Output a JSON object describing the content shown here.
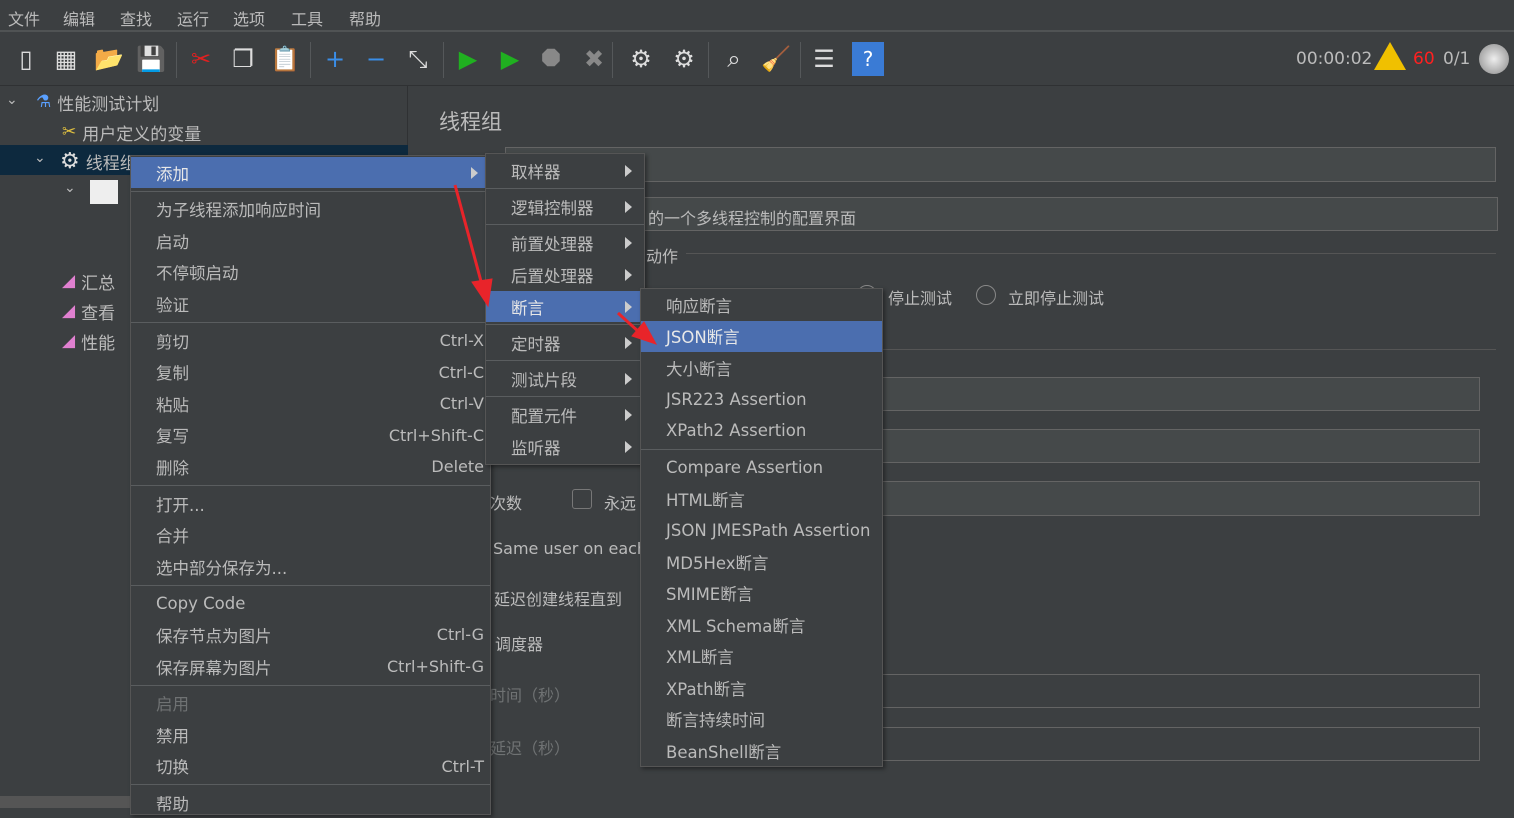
{
  "menubar": [
    "文件",
    "编辑",
    "查找",
    "运行",
    "选项",
    "工具",
    "帮助"
  ],
  "toolbar": {
    "timer": "00:00:02",
    "warning_count": "60",
    "threads": "0/1",
    "colors": {
      "warning_count": "#ff2020"
    },
    "icons": [
      "new-icon",
      "templates-icon",
      "open-icon",
      "save-icon",
      "cut-icon",
      "copy-icon",
      "paste-icon",
      "expand-icon",
      "collapse-icon",
      "toggle-icon",
      "start-icon",
      "start-no-pause-icon",
      "stop-icon",
      "shutdown-icon",
      "clear-icon",
      "clear-all-icon",
      "search-icon",
      "reset-search-icon",
      "function-helper-icon",
      "help-icon"
    ]
  },
  "tree": {
    "items": [
      "性能测试计划",
      "用户定义的变量",
      "线程组",
      "汇总",
      "查看",
      "性能"
    ]
  },
  "panel": {
    "title": "线程组",
    "comment": "的一个多线程控制的配置界面",
    "action_label": "动作",
    "stop_test": "停止测试",
    "stop_now": "立即停止测试",
    "loops": "次数",
    "forever": "永远",
    "same_user": "Same user on each",
    "delay_create": "延迟创建线程直到",
    "scheduler": "调度器",
    "duration": "时间（秒）",
    "startup_delay": "延迟（秒）"
  },
  "context_menu": {
    "groups": [
      [
        {
          "label": "添加",
          "submenu": true,
          "highlighted": true
        }
      ],
      [
        {
          "label": "为子线程添加响应时间"
        },
        {
          "label": "启动"
        },
        {
          "label": "不停顿启动"
        },
        {
          "label": "验证"
        }
      ],
      [
        {
          "label": "剪切",
          "shortcut": "Ctrl-X"
        },
        {
          "label": "复制",
          "shortcut": "Ctrl-C"
        },
        {
          "label": "粘贴",
          "shortcut": "Ctrl-V"
        },
        {
          "label": "复写",
          "shortcut": "Ctrl+Shift-C"
        },
        {
          "label": "删除",
          "shortcut": "Delete"
        }
      ],
      [
        {
          "label": "打开..."
        },
        {
          "label": "合并"
        },
        {
          "label": "选中部分保存为..."
        }
      ],
      [
        {
          "label": "Copy Code"
        },
        {
          "label": "保存节点为图片",
          "shortcut": "Ctrl-G"
        },
        {
          "label": "保存屏幕为图片",
          "shortcut": "Ctrl+Shift-G"
        }
      ],
      [
        {
          "label": "启用",
          "disabled": true
        },
        {
          "label": "禁用"
        },
        {
          "label": "切换",
          "shortcut": "Ctrl-T"
        }
      ],
      [
        {
          "label": "帮助"
        }
      ]
    ]
  },
  "add_submenu": [
    {
      "label": "取样器"
    },
    {
      "label": "逻辑控制器"
    },
    {
      "label": "前置处理器"
    },
    {
      "label": "后置处理器"
    },
    {
      "label": "断言",
      "highlighted": true
    },
    {
      "label": "定时器"
    },
    {
      "label": "测试片段"
    },
    {
      "label": "配置元件"
    },
    {
      "label": "监听器"
    }
  ],
  "assertion_submenu": [
    {
      "label": "响应断言"
    },
    {
      "label": "JSON断言",
      "highlighted": true
    },
    {
      "label": "大小断言"
    },
    {
      "label": "JSR223 Assertion"
    },
    {
      "label": "XPath2 Assertion"
    },
    {
      "label": "Compare Assertion"
    },
    {
      "label": "HTML断言"
    },
    {
      "label": "JSON JMESPath Assertion"
    },
    {
      "label": "MD5Hex断言"
    },
    {
      "label": "SMIME断言"
    },
    {
      "label": "XML Schema断言"
    },
    {
      "label": "XML断言"
    },
    {
      "label": "XPath断言"
    },
    {
      "label": "断言持续时间"
    },
    {
      "label": "BeanShell断言"
    }
  ],
  "colors": {
    "background": "#3c3f41",
    "highlight": "#4b6eaf",
    "arrow": "#e8242a"
  }
}
